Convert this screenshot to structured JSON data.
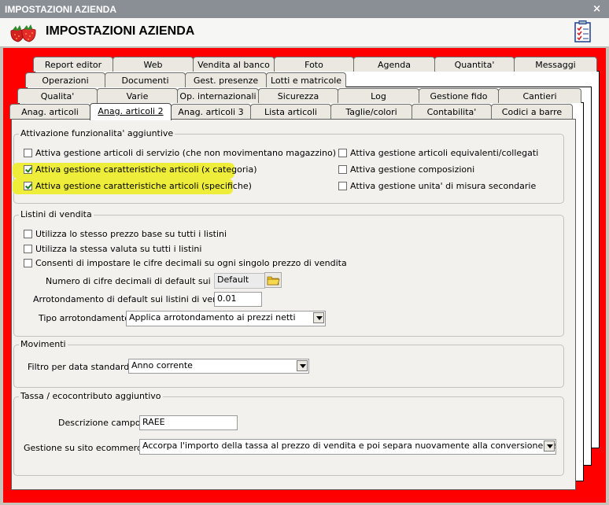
{
  "window": {
    "title": "IMPOSTAZIONI AZIENDA",
    "close_glyph": "×"
  },
  "header": {
    "title": "IMPOSTAZIONI AZIENDA",
    "logo_icon": "strawberry-icon",
    "action_icon": "checklist-icon"
  },
  "tabs": {
    "row1": [
      "Report editor",
      "Web",
      "Vendita al banco",
      "Foto",
      "Agenda",
      "Quantita'",
      "Messaggi"
    ],
    "row2": [
      "Operazioni",
      "Documenti",
      "Gest. presenze",
      "Lotti e matricole"
    ],
    "row3": [
      "Qualita'",
      "Varie",
      "Op. internazionali",
      "Sicurezza",
      "Log",
      "Gestione fido",
      "Cantieri"
    ],
    "row4": [
      "Anag. articoli",
      "Anag. articoli 2",
      "Anag. articoli 3",
      "Lista articoli",
      "Taglie/colori",
      "Contabilita'",
      "Codici a barre"
    ],
    "active": "Anag. articoli 2"
  },
  "features": {
    "title": "Attivazione funzionalita' aggiuntive",
    "left": [
      {
        "label": "Attiva gestione articoli di servizio (che non movimentano magazzino)",
        "checked": false
      },
      {
        "label": "Attiva gestione caratteristiche articoli (x categoria)",
        "checked": true
      },
      {
        "label": "Attiva gestione caratteristiche articoli (specifiche)",
        "checked": true
      }
    ],
    "right": [
      {
        "label": "Attiva gestione articoli equivalenti/collegati",
        "checked": false
      },
      {
        "label": "Attiva gestione composizioni",
        "checked": false
      },
      {
        "label": "Attiva gestione unita' di misura secondarie",
        "checked": false
      }
    ]
  },
  "price_lists": {
    "title": "Listini di vendita",
    "options": [
      {
        "label": "Utilizza lo stesso prezzo base su tutti i listini",
        "checked": false
      },
      {
        "label": "Utilizza la stessa valuta su tutti i listini",
        "checked": false
      },
      {
        "label": "Consenti di impostare le cifre decimali su ogni singolo prezzo di vendita",
        "checked": false
      }
    ],
    "decimals_label": "Numero di cifre decimali di default sui listini :",
    "decimals_value": "Default",
    "rounding_label": "Arrotondamento di default sui listini di vendita :",
    "rounding_value": "0.01",
    "rounding_type_label": "Tipo arrotondamento :",
    "rounding_type_value": "Applica arrotondamento ai prezzi netti"
  },
  "movements": {
    "title": "Movimenti",
    "filter_label": "Filtro per data standard :",
    "filter_value": "Anno corrente"
  },
  "tax": {
    "title": "Tassa / ecocontributo aggiuntivo",
    "description_label": "Descrizione campo :",
    "description_value": "RAEE",
    "ecommerce_label": "Gestione su sito ecommerce :",
    "ecommerce_value": "Accorpa l'importo della tassa al prezzo di vendita e poi separa nuovamente alla conversione dell'ordine web"
  }
}
